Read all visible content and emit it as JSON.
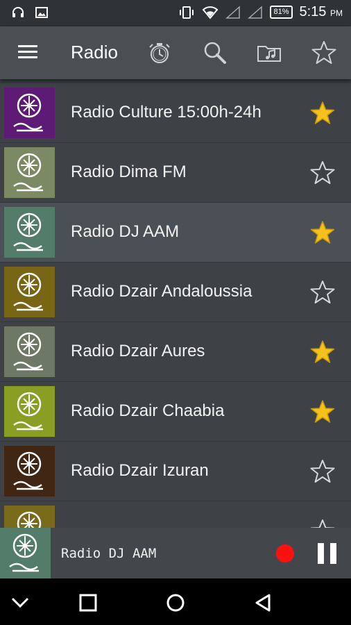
{
  "status_bar": {
    "battery": "81%",
    "time": "5:15",
    "ampm": "PM",
    "icons": [
      "headset-icon",
      "image-icon",
      "vibrate-icon",
      "wifi-icon",
      "signal-icon",
      "signal-icon",
      "battery-icon"
    ]
  },
  "app_bar": {
    "title": "Radio",
    "icons": [
      "menu-icon",
      "alarm-clock-icon",
      "search-icon",
      "music-folder-icon",
      "star-outline-icon"
    ]
  },
  "list": {
    "items": [
      {
        "label": "Radio Culture 15:00h-24h",
        "favorite": true,
        "thumb_color": "#6a1f86",
        "selected": false
      },
      {
        "label": "Radio Dima FM",
        "favorite": false,
        "thumb_color": "#8c9e71",
        "selected": false
      },
      {
        "label": "Radio DJ AAM",
        "favorite": true,
        "thumb_color": "#5f8f78",
        "selected": true
      },
      {
        "label": "Radio Dzair Andaloussia",
        "favorite": false,
        "thumb_color": "#8a7519",
        "selected": false
      },
      {
        "label": "Radio Dzair Aures",
        "favorite": true,
        "thumb_color": "#7d8a72",
        "selected": false
      },
      {
        "label": "Radio Dzair Chaabia",
        "favorite": true,
        "thumb_color": "#9fb42a",
        "selected": false
      },
      {
        "label": "Radio Dzair Izuran",
        "favorite": false,
        "thumb_color": "#4b2c17",
        "selected": false
      },
      {
        "label": "",
        "favorite": false,
        "thumb_color": "#8a7a1f",
        "selected": false
      }
    ]
  },
  "player": {
    "title": "Radio DJ AAM",
    "thumb_color": "#5f8f78",
    "record_color": "#ff1010"
  },
  "nav_bar": {
    "icons": [
      "back-chevron-icon",
      "recents-square-icon",
      "home-circle-icon",
      "back-triangle-icon"
    ]
  },
  "colors": {
    "accent_star": "#f4c21a",
    "background": "#3e4246",
    "selected_row": "#4b5056",
    "app_bar": "#4a4f54"
  }
}
